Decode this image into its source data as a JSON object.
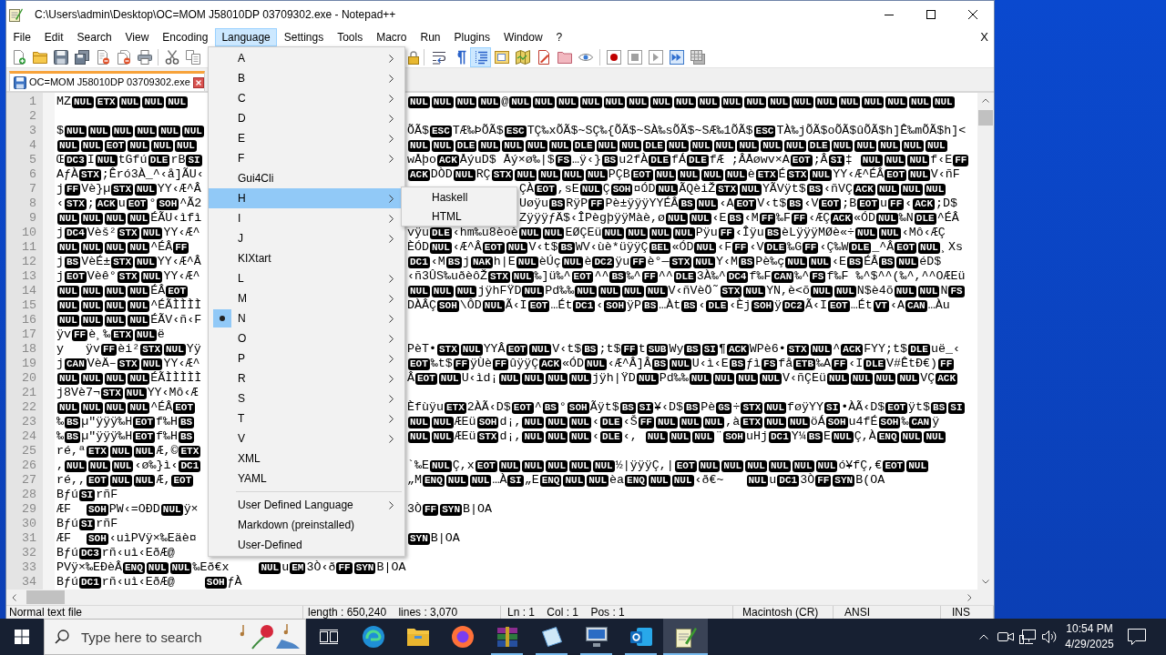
{
  "window": {
    "title": "C:\\Users\\admin\\Desktop\\OC=MOM J58010DP 03709302.exe - Notepad++"
  },
  "menu_bar": {
    "items": [
      {
        "label": "File",
        "selected": false
      },
      {
        "label": "Edit",
        "selected": false
      },
      {
        "label": "Search",
        "selected": false
      },
      {
        "label": "View",
        "selected": false
      },
      {
        "label": "Encoding",
        "selected": false
      },
      {
        "label": "Language",
        "selected": true
      },
      {
        "label": "Settings",
        "selected": false
      },
      {
        "label": "Tools",
        "selected": false
      },
      {
        "label": "Macro",
        "selected": false
      },
      {
        "label": "Run",
        "selected": false
      },
      {
        "label": "Plugins",
        "selected": false
      },
      {
        "label": "Window",
        "selected": false
      },
      {
        "label": "?",
        "selected": false
      }
    ],
    "close_button": "X"
  },
  "toolbar": {
    "buttons": [
      {
        "pressed": false
      },
      {
        "pressed": false
      },
      {
        "pressed": false
      },
      {
        "pressed": false
      },
      {
        "pressed": false
      },
      {
        "pressed": false
      },
      {
        "pressed": false
      },
      {
        "pressed": false
      },
      {
        "pressed": false
      },
      {
        "pressed": false
      },
      {
        "pressed": false
      },
      {
        "pressed": false
      },
      {
        "pressed": true
      },
      {
        "pressed": false
      },
      {
        "pressed": false
      },
      {
        "pressed": false
      },
      {
        "pressed": false
      },
      {
        "pressed": false
      },
      {
        "pressed": false
      },
      {
        "pressed": false
      },
      {
        "pressed": false
      },
      {
        "pressed": false
      },
      {
        "pressed": false
      }
    ]
  },
  "tabs": [
    {
      "label": "OC=MOM J58010DP 03709302.exe",
      "selected": true
    }
  ],
  "editor": {
    "lines": [
      {
        "number": "1",
        "left": [
          "MZ",
          [
            "NUL"
          ],
          [
            "ETX"
          ],
          [
            "NUL"
          ],
          [
            "NUL"
          ],
          [
            "NUL"
          ]
        ],
        "right": [
          [
            "NUL"
          ],
          [
            "NUL"
          ],
          [
            "NUL"
          ],
          [
            "NUL"
          ],
          "@",
          [
            "NUL"
          ],
          [
            "NUL"
          ],
          [
            "NUL"
          ],
          [
            "NUL"
          ],
          [
            "NUL"
          ],
          [
            "NUL"
          ],
          [
            "NUL"
          ],
          [
            "NUL"
          ],
          [
            "NUL"
          ],
          [
            "NUL"
          ],
          [
            "NUL"
          ],
          [
            "NUL"
          ],
          [
            "NUL"
          ],
          [
            "NUL"
          ],
          [
            "NUL"
          ],
          [
            "NUL"
          ],
          [
            "NUL"
          ],
          [
            "NUL"
          ],
          [
            "NUL"
          ]
        ]
      },
      {
        "number": "2"
      },
      {
        "number": "3",
        "left": [
          "$",
          [
            "NUL"
          ],
          [
            "NUL"
          ],
          [
            "NUL"
          ],
          [
            "NUL"
          ],
          [
            "NUL"
          ],
          [
            "NUL"
          ]
        ],
        "right": [
          "ÕÃ$",
          [
            "ESC"
          ],
          "TÆ‰ÞÕÃ$",
          [
            "ESC"
          ],
          "TÇ‰xÕÃ$~SÇ‰{ÕÃ$~SÀ‰sÕÃ$~SÆ‰1ÕÃ$",
          [
            "ESC"
          ],
          "TÀ‰jÕÃ$oÕÃ$ûÕÃ$h]Ê‰mÕÃ$h]<"
        ]
      },
      {
        "number": "4",
        "left": [
          [
            "NUL"
          ],
          [
            "NUL"
          ],
          [
            "EOT"
          ],
          [
            "NUL"
          ],
          [
            "NUL"
          ],
          [
            "NUL"
          ]
        ],
        "right": [
          [
            "NUL"
          ],
          [
            "NUL"
          ],
          [
            "DLE"
          ],
          [
            "NUL"
          ],
          [
            "NUL"
          ],
          [
            "NUL"
          ],
          [
            "NUL"
          ],
          [
            "DLE"
          ],
          [
            "NUL"
          ],
          [
            "NUL"
          ],
          [
            "DLE"
          ],
          [
            "NUL"
          ],
          [
            "NUL"
          ],
          [
            "NUL"
          ],
          [
            "NUL"
          ],
          [
            "NUL"
          ],
          [
            "NUL"
          ],
          [
            "DLE"
          ],
          [
            "NUL"
          ],
          [
            "NUL"
          ],
          [
            "NUL"
          ],
          [
            "NUL"
          ],
          [
            "NUL"
          ]
        ]
      },
      {
        "number": "5",
        "left": [
          "Œ",
          [
            "DC3"
          ],
          "I",
          [
            "NUL"
          ],
          "tGfú",
          [
            "DLE"
          ],
          "rB",
          [
            "SI"
          ]
        ],
        "right": [
          "wÅþo",
          [
            "ACK"
          ],
          "ÅýuD$ Åý×ø‰|$",
          [
            "FS"
          ],
          "…ÿ‹}",
          [
            "BS"
          ],
          "u2fÀ",
          [
            "DLE"
          ],
          "fÁ",
          [
            "DLE"
          ],
          "fÆ ;ÂÅøwv×A",
          [
            "EOT"
          ],
          ";Â",
          [
            "SI"
          ],
          "‡ ",
          [
            "NUL"
          ],
          [
            "NUL"
          ],
          [
            "NUL"
          ],
          "f‹E",
          [
            "FF"
          ]
        ]
      },
      {
        "number": "6",
        "left": [
          "AƒÀ",
          [
            "STX"
          ],
          ";Êró3À_^‹å]ÃU‹"
        ],
        "right": [
          [
            "ACK"
          ],
          "DÒD",
          [
            "NUL"
          ],
          "RÇ",
          [
            "STX"
          ],
          [
            "NUL"
          ],
          [
            "NUL"
          ],
          [
            "NUL"
          ],
          [
            "NUL"
          ],
          "PÇB",
          [
            "EOT"
          ],
          [
            "NUL"
          ],
          [
            "NUL"
          ],
          [
            "NUL"
          ],
          [
            "NUL"
          ],
          "è",
          [
            "ETX"
          ],
          "É",
          [
            "STX"
          ],
          [
            "NUL"
          ],
          "YY‹Æ^ÉÂ",
          [
            "EOT"
          ],
          [
            "NUL"
          ],
          "V‹ñF"
        ]
      },
      {
        "number": "7",
        "left": [
          "j",
          [
            "FF"
          ],
          "Vè}µ",
          [
            "STX"
          ],
          [
            "NUL"
          ],
          "YY‹Æ^Â"
        ],
        "right": [
          "ÇÀ",
          [
            "EOT"
          ],
          ",sE",
          [
            "NUL"
          ],
          "Ç",
          [
            "SOH"
          ],
          "¤ÓD",
          [
            "NUL"
          ],
          "ÃQèiŽ",
          [
            "STX"
          ],
          [
            "NUL"
          ],
          "YÃVÿt$",
          [
            "BS"
          ],
          "‹ñVÇ",
          [
            "ACK"
          ],
          [
            "NUL"
          ],
          [
            "NUL"
          ],
          [
            "NUL"
          ]
        ]
      },
      {
        "number": "8",
        "left": [
          "‹",
          [
            "STX"
          ],
          ";",
          [
            "ACK"
          ],
          "u",
          [
            "EOT"
          ],
          "°",
          [
            "SOH"
          ],
          "^Ã2"
        ],
        "right": [
          "Uøÿu",
          [
            "BS"
          ],
          "RÿP",
          [
            "FF"
          ],
          "Pè±ÿÿÿYYÉÂ",
          [
            "BS"
          ],
          [
            "NUL"
          ],
          "‹A",
          [
            "EOT"
          ],
          "V‹t$",
          [
            "BS"
          ],
          "‹V",
          [
            "EOT"
          ],
          ";B",
          [
            "EOT"
          ],
          "u",
          [
            "FF"
          ],
          "‹",
          [
            "ACK"
          ],
          ";D$"
        ]
      },
      {
        "number": "9",
        "left": [
          [
            "NUL"
          ],
          [
            "NUL"
          ],
          [
            "NUL"
          ],
          [
            "NUL"
          ],
          "ÉÃU‹ìfì"
        ],
        "right": [
          "ZÿÿÿƒÄ$‹ÎPègþÿÿMàè,ø",
          [
            "NUL"
          ],
          [
            "NUL"
          ],
          "‹E",
          [
            "BS"
          ],
          "‹M",
          [
            "FF"
          ],
          "‰F",
          [
            "FF"
          ],
          "‹ÆÇ",
          [
            "ACK"
          ],
          "«ÓD",
          [
            "NUL"
          ],
          "‰N",
          [
            "DLE"
          ],
          "^ÉÂ"
        ]
      },
      {
        "number": "10",
        "left": [
          "j",
          [
            "DC4"
          ],
          "Vèš²",
          [
            "STX"
          ],
          [
            "NUL"
          ],
          "YY‹Æ^"
        ],
        "right": [
          "vÿu",
          [
            "DLE"
          ],
          "‹hm‰u8èoè",
          [
            "NUL"
          ],
          [
            "NUL"
          ],
          "EØÇEü",
          [
            "NUL"
          ],
          [
            "NUL"
          ],
          [
            "NUL"
          ],
          [
            "NUL"
          ],
          "Pÿu",
          [
            "FF"
          ],
          "‹Îÿu",
          [
            "BS"
          ],
          "èLÿÿÿMØè«÷",
          [
            "NUL"
          ],
          [
            "NUL"
          ],
          "‹Mô‹ÆÇ"
        ]
      },
      {
        "number": "11",
        "left": [
          [
            "NUL"
          ],
          [
            "NUL"
          ],
          [
            "NUL"
          ],
          [
            "NUL"
          ],
          "^ÉÂ",
          [
            "FF"
          ]
        ],
        "right": [
          "ÈÓD",
          [
            "NUL"
          ],
          "‹Æ^Â",
          [
            "EOT"
          ],
          [
            "NUL"
          ],
          "V‹t$",
          [
            "BS"
          ],
          "WV‹ùè*üÿÿÇ",
          [
            "BEL"
          ],
          "«ÓD",
          [
            "NUL"
          ],
          "‹F",
          [
            "FF"
          ],
          "‹V",
          [
            "DLE"
          ],
          "‰G",
          [
            "FF"
          ],
          "‹Ç‰W",
          [
            "DLE"
          ],
          "_^Â",
          [
            "EOT"
          ],
          [
            "NUL"
          ],
          "¸Xs"
        ]
      },
      {
        "number": "12",
        "left": [
          "j",
          [
            "BS"
          ],
          "VèÉ±",
          [
            "STX"
          ],
          [
            "NUL"
          ],
          "YY‹Æ^Â"
        ],
        "right": [
          [
            "DC1"
          ],
          "‹M",
          [
            "BS"
          ],
          "j",
          [
            "NAK"
          ],
          "h|E",
          [
            "NUL"
          ],
          "èÚç",
          [
            "NUL"
          ],
          "è",
          [
            "DC2"
          ],
          "ÿu",
          [
            "FF"
          ],
          "è°—",
          [
            "STX"
          ],
          [
            "NUL"
          ],
          "Y‹M",
          [
            "BS"
          ],
          "Pè‰ç",
          [
            "NUL"
          ],
          [
            "NUL"
          ],
          "‹E",
          [
            "BS"
          ],
          "ÉÂ",
          [
            "BS"
          ],
          [
            "NUL"
          ],
          "éD$"
        ]
      },
      {
        "number": "13",
        "left": [
          "j",
          [
            "EOT"
          ],
          "Vèê°",
          [
            "STX"
          ],
          [
            "NUL"
          ],
          "YY‹Æ^"
        ],
        "right": [
          "‹ñ3ÛS‰uðèôŽ",
          [
            "STX"
          ],
          [
            "NUL"
          ],
          "‰]ü‰^",
          [
            "EOT"
          ],
          "^^",
          [
            "BS"
          ],
          "‰^",
          [
            "FF"
          ],
          "^^",
          [
            "DLE"
          ],
          "3À‰^",
          [
            "DC4"
          ],
          "f‰F",
          [
            "CAN"
          ],
          "‰^",
          [
            "FS"
          ],
          "f‰F ‰^$^^(‰^,^^OÆEü"
        ]
      },
      {
        "number": "14",
        "left": [
          [
            "NUL"
          ],
          [
            "NUL"
          ],
          [
            "NUL"
          ],
          [
            "NUL"
          ],
          "ÉÂ",
          [
            "EOT"
          ]
        ],
        "right": [
          [
            "NUL"
          ],
          [
            "NUL"
          ],
          [
            "NUL"
          ],
          "jÿhFŸD",
          [
            "NUL"
          ],
          "Pd‰‰",
          [
            "NUL"
          ],
          [
            "NUL"
          ],
          [
            "NUL"
          ],
          [
            "NUL"
          ],
          "V‹ñVèÖ˜",
          [
            "STX"
          ],
          [
            "NUL"
          ],
          "YN,è<õ",
          [
            "NUL"
          ],
          [
            "NUL"
          ],
          "N$è4õ",
          [
            "NUL"
          ],
          [
            "NUL"
          ],
          "N",
          [
            "FS"
          ]
        ]
      },
      {
        "number": "15",
        "left": [
          [
            "NUL"
          ],
          [
            "NUL"
          ],
          [
            "NUL"
          ],
          [
            "NUL"
          ],
          "^ÉÃÌÌÌÌ"
        ],
        "right": [
          "DÀÂÇ",
          [
            "SOH"
          ],
          "\\ÔD",
          [
            "NUL"
          ],
          "Ã",
          "‹I",
          [
            "EOT"
          ],
          "…Ét",
          [
            "DC1"
          ],
          "‹",
          [
            "SOH"
          ],
          "ÿP",
          [
            "BS"
          ],
          "…Àt",
          [
            "BS"
          ],
          "‹",
          [
            "DLE"
          ],
          "‹Èj",
          [
            "SOH"
          ],
          "ÿ",
          [
            "DC2"
          ],
          "Ã",
          "‹I",
          [
            "EOT"
          ],
          "…Ét",
          [
            "VT"
          ],
          "‹A",
          [
            "CAN"
          ],
          "…Àu"
        ]
      },
      {
        "number": "16",
        "left": [
          [
            "NUL"
          ],
          [
            "NUL"
          ],
          [
            "NUL"
          ],
          [
            "NUL"
          ],
          "ÉÃV‹ñ‹F"
        ]
      },
      {
        "number": "17",
        "left": [
          "ÿv",
          [
            "FF"
          ],
          "è¸‰",
          [
            "ETX"
          ],
          [
            "NUL"
          ],
          "ë"
        ]
      },
      {
        "number": "18",
        "left": [
          "y   ÿv",
          [
            "FF"
          ],
          "èi²",
          [
            "STX"
          ],
          [
            "NUL"
          ],
          "Yÿ"
        ],
        "right": [
          "PèT•",
          [
            "STX"
          ],
          [
            "NUL"
          ],
          "YYÂ",
          [
            "EOT"
          ],
          [
            "NUL"
          ],
          "V‹t$",
          [
            "BS"
          ],
          ";t$",
          [
            "FF"
          ],
          "t",
          [
            "SUB"
          ],
          "Wy",
          [
            "BS"
          ],
          [
            "SI"
          ],
          "¶",
          [
            "ACK"
          ],
          "WPè6•",
          [
            "STX"
          ],
          [
            "NUL"
          ],
          "^",
          [
            "ACK"
          ],
          "FYY;t$",
          [
            "DLE"
          ],
          "uë_‹"
        ]
      },
      {
        "number": "19",
        "left": [
          "j",
          [
            "CAN"
          ],
          "VèÄ–",
          [
            "STX"
          ],
          [
            "NUL"
          ],
          "YY‹Æ^"
        ],
        "right": [
          [
            "EOT"
          ],
          "‰t$",
          [
            "FF"
          ],
          "ÿÙè",
          [
            "FF"
          ],
          "ûÿÿÇ",
          [
            "ACK"
          ],
          "«ÓD",
          [
            "NUL"
          ],
          "‹Æ^Â]Â",
          [
            "BS"
          ],
          [
            "NUL"
          ],
          "U‹ì‹E",
          [
            "BS"
          ],
          "ƒì",
          [
            "FS"
          ],
          "få",
          [
            "ETB"
          ],
          "‰A",
          [
            "FF"
          ],
          "‹I",
          [
            "DLE"
          ],
          "V#ÊtÐ€)",
          [
            "FF"
          ]
        ]
      },
      {
        "number": "20",
        "left": [
          [
            "NUL"
          ],
          [
            "NUL"
          ],
          [
            "NUL"
          ],
          [
            "NUL"
          ],
          "ÉÃÌÌÌÌÌ"
        ],
        "right": [
          "Â",
          [
            "EOT"
          ],
          [
            "NUL"
          ],
          "U‹ìd¡",
          [
            "NUL"
          ],
          [
            "NUL"
          ],
          [
            "NUL"
          ],
          [
            "NUL"
          ],
          "jÿh|ŸD",
          [
            "NUL"
          ],
          "Pd‰‰",
          [
            "NUL"
          ],
          [
            "NUL"
          ],
          [
            "NUL"
          ],
          [
            "NUL"
          ],
          "V‹ñÇEü",
          [
            "NUL"
          ],
          [
            "NUL"
          ],
          [
            "NUL"
          ],
          [
            "NUL"
          ],
          "VÇ",
          [
            "ACK"
          ]
        ]
      },
      {
        "number": "21",
        "left": [
          "j8Vè7¬",
          [
            "STX"
          ],
          [
            "NUL"
          ],
          "YY‹Mô‹Æ"
        ]
      },
      {
        "number": "22",
        "left": [
          [
            "NUL"
          ],
          [
            "NUL"
          ],
          [
            "NUL"
          ],
          [
            "NUL"
          ],
          "^ÉÂ",
          [
            "EOT"
          ]
        ],
        "right": [
          "Èfùÿu",
          [
            "ETX"
          ],
          "2ÀÃ",
          "‹D$",
          [
            "EOT"
          ],
          "^",
          [
            "BS"
          ],
          "°",
          [
            "SOH"
          ],
          "Ãÿt$",
          [
            "BS"
          ],
          [
            "SI"
          ],
          "¥‹D$",
          [
            "BS"
          ],
          "Pè",
          [
            "GS"
          ],
          "÷",
          [
            "STX"
          ],
          [
            "NUL"
          ],
          "føÿYY",
          [
            "SI"
          ],
          "•ÀÃ",
          "‹D$",
          [
            "EOT"
          ],
          "ÿt$",
          [
            "BS"
          ],
          [
            "SI"
          ]
        ]
      },
      {
        "number": "23",
        "left": [
          "‰",
          [
            "BS"
          ],
          "µ\"ÿÿÿ‰H",
          [
            "EOT"
          ],
          "f‰H",
          [
            "BS"
          ]
        ],
        "right": [
          [
            "NUL"
          ],
          [
            "NUL"
          ],
          "ÆEü",
          [
            "SOH"
          ],
          "d¡,",
          [
            "NUL"
          ],
          [
            "NUL"
          ],
          [
            "NUL"
          ],
          "‹",
          [
            "DLE"
          ],
          "‹Š",
          [
            "FF"
          ],
          [
            "NUL"
          ],
          [
            "NUL"
          ],
          [
            "NUL"
          ],
          ",à",
          [
            "ETX"
          ],
          [
            "NUL"
          ],
          [
            "NUL"
          ],
          "öÁ",
          [
            "SOH"
          ],
          "u4fÉ",
          [
            "SOH"
          ],
          "‰",
          [
            "CAN"
          ],
          "ÿ"
        ]
      },
      {
        "number": "24",
        "left": [
          "‰",
          [
            "BS"
          ],
          "µ\"ÿÿÿ‰H",
          [
            "EOT"
          ],
          "f‰H",
          [
            "BS"
          ]
        ],
        "right": [
          [
            "NUL"
          ],
          [
            "NUL"
          ],
          "ÆEü",
          [
            "STX"
          ],
          "d¡,",
          [
            "NUL"
          ],
          [
            "NUL"
          ],
          [
            "NUL"
          ],
          "‹",
          [
            "DLE"
          ],
          "‹, ",
          [
            "NUL"
          ],
          [
            "NUL"
          ],
          [
            "NUL"
          ],
          "¨",
          [
            "SOH"
          ],
          "uHj",
          [
            "DC1"
          ],
          "Y¼",
          [
            "BS"
          ],
          "E",
          [
            "NUL"
          ],
          "Ç,À",
          [
            "ENQ"
          ],
          [
            "NUL"
          ],
          [
            "NUL"
          ]
        ]
      },
      {
        "number": "25",
        "left": [
          "ré,ª",
          [
            "ETX"
          ],
          [
            "NUL"
          ],
          [
            "NUL"
          ],
          "Æ,©",
          [
            "ETX"
          ]
        ]
      },
      {
        "number": "26",
        "left": [
          ",",
          [
            "NUL"
          ],
          [
            "NUL"
          ],
          [
            "NUL"
          ],
          "‹ø‰}ì‹",
          [
            "DC1"
          ]
        ],
        "right": [
          "`‰E",
          [
            "NUL"
          ],
          "Ç,x",
          [
            "EOT"
          ],
          [
            "NUL"
          ],
          [
            "NUL"
          ],
          [
            "NUL"
          ],
          [
            "NUL"
          ],
          [
            "NUL"
          ],
          "½|ÿÿÿÇ,|",
          [
            "EOT"
          ],
          [
            "NUL"
          ],
          [
            "NUL"
          ],
          [
            "NUL"
          ],
          [
            "NUL"
          ],
          [
            "NUL"
          ],
          [
            "NUL"
          ],
          "ó¥fÇ,€",
          [
            "EOT"
          ],
          [
            "NUL"
          ]
        ]
      },
      {
        "number": "27",
        "left": [
          "ré,,",
          [
            "EOT"
          ],
          [
            "NUL"
          ],
          [
            "NUL"
          ],
          "Æ,",
          [
            "EOT"
          ]
        ],
        "right": [
          "„M",
          [
            "ENQ"
          ],
          [
            "NUL"
          ],
          [
            "NUL"
          ],
          "…À",
          [
            "SI"
          ],
          "„E",
          [
            "ENQ"
          ],
          [
            "NUL"
          ],
          [
            "NUL"
          ],
          "èa",
          [
            "ENQ"
          ],
          [
            "NUL"
          ],
          [
            "NUL"
          ],
          "‹ð€~   ",
          [
            "NUL"
          ],
          "u",
          [
            "DC1"
          ],
          "3Ò",
          [
            "FF"
          ],
          [
            "SYN"
          ],
          "B(OA"
        ]
      },
      {
        "number": "28",
        "left": [
          "Bƒú",
          [
            "SI"
          ],
          "rñF"
        ]
      },
      {
        "number": "29",
        "left": [
          "ÆF  ",
          [
            "SOH"
          ],
          "PW‹=OÐD",
          [
            "NUL"
          ],
          "ÿ×"
        ],
        "right": [
          "3Ò",
          [
            "FF"
          ],
          [
            "SYN"
          ],
          "B|OA"
        ]
      },
      {
        "number": "30",
        "left": [
          "Bƒú",
          [
            "SI"
          ],
          "rñF"
        ]
      },
      {
        "number": "31",
        "left": [
          "ÆF  ",
          [
            "SOH"
          ],
          "‹uìPVÿ×‰Eäè¤"
        ],
        "right": [
          [
            "SYN"
          ],
          "B|OA"
        ]
      },
      {
        "number": "32",
        "left": [
          "Bƒú",
          [
            "DC3"
          ],
          "rñ‹uì‹EðÆ@"
        ]
      },
      {
        "number": "33",
        "left": [
          "PVÿ×‰EÐèÂ",
          [
            "ENQ"
          ],
          [
            "NUL"
          ],
          [
            "NUL"
          ],
          "‰Eð€x    ",
          [
            "NUL"
          ],
          "u",
          [
            "EM"
          ],
          "3Ò‹ð",
          [
            "FF"
          ],
          [
            "SYN"
          ],
          "B|OA"
        ]
      },
      {
        "number": "34",
        "left": [
          "Bƒú",
          [
            "DC1"
          ],
          "rñ‹uì‹EðÆ@    ",
          [
            "SOH"
          ],
          "ƒÀ"
        ]
      }
    ]
  },
  "language_menu": {
    "items": [
      {
        "kind": "item",
        "label": "A",
        "submenu": true,
        "selected": false,
        "checked": false
      },
      {
        "kind": "item",
        "label": "B",
        "submenu": true,
        "selected": false,
        "checked": false
      },
      {
        "kind": "item",
        "label": "C",
        "submenu": true,
        "selected": false,
        "checked": false
      },
      {
        "kind": "item",
        "label": "D",
        "submenu": true,
        "selected": false,
        "checked": false
      },
      {
        "kind": "item",
        "label": "E",
        "submenu": true,
        "selected": false,
        "checked": false
      },
      {
        "kind": "item",
        "label": "F",
        "submenu": true,
        "selected": false,
        "checked": false
      },
      {
        "kind": "item",
        "label": "Gui4Cli",
        "submenu": false,
        "selected": false,
        "checked": false
      },
      {
        "kind": "item",
        "label": "H",
        "submenu": true,
        "selected": true,
        "checked": false
      },
      {
        "kind": "item",
        "label": "I",
        "submenu": true,
        "selected": false,
        "checked": false
      },
      {
        "kind": "item",
        "label": "J",
        "submenu": true,
        "selected": false,
        "checked": false
      },
      {
        "kind": "item",
        "label": "KIXtart",
        "submenu": false,
        "selected": false,
        "checked": false
      },
      {
        "kind": "item",
        "label": "L",
        "submenu": true,
        "selected": false,
        "checked": false
      },
      {
        "kind": "item",
        "label": "M",
        "submenu": true,
        "selected": false,
        "checked": false
      },
      {
        "kind": "item",
        "label": "N",
        "submenu": true,
        "selected": false,
        "checked": true
      },
      {
        "kind": "item",
        "label": "O",
        "submenu": true,
        "selected": false,
        "checked": false
      },
      {
        "kind": "item",
        "label": "P",
        "submenu": true,
        "selected": false,
        "checked": false
      },
      {
        "kind": "item",
        "label": "R",
        "submenu": true,
        "selected": false,
        "checked": false
      },
      {
        "kind": "item",
        "label": "S",
        "submenu": true,
        "selected": false,
        "checked": false
      },
      {
        "kind": "item",
        "label": "T",
        "submenu": true,
        "selected": false,
        "checked": false
      },
      {
        "kind": "item",
        "label": "V",
        "submenu": true,
        "selected": false,
        "checked": false
      },
      {
        "kind": "item",
        "label": "XML",
        "submenu": false,
        "selected": false,
        "checked": false
      },
      {
        "kind": "item",
        "label": "YAML",
        "submenu": false,
        "selected": false,
        "checked": false
      },
      {
        "kind": "separator"
      },
      {
        "kind": "item",
        "label": "User Defined Language",
        "submenu": true,
        "selected": false,
        "checked": false
      },
      {
        "kind": "item",
        "label": "Markdown (preinstalled)",
        "submenu": false,
        "selected": false,
        "checked": false
      },
      {
        "kind": "item",
        "label": "User-Defined",
        "submenu": false,
        "selected": false,
        "checked": false
      }
    ]
  },
  "h_submenu": {
    "items": [
      {
        "label": "Haskell",
        "selected": false
      },
      {
        "label": "HTML",
        "selected": false
      }
    ]
  },
  "status_bar": {
    "cells": [
      "Normal text file",
      "length : 650,240    lines : 3,070",
      "Ln : 1    Col : 1    Pos : 1",
      "Macintosh (CR)",
      "ANSI",
      "INS"
    ]
  },
  "taskbar": {
    "search": {
      "placeholder": "Type here to search"
    },
    "apps": [
      {
        "running": false,
        "active": false
      },
      {
        "running": false,
        "active": false
      },
      {
        "running": false,
        "active": false
      },
      {
        "running": true,
        "active": false
      },
      {
        "running": true,
        "active": false
      },
      {
        "running": true,
        "active": false
      },
      {
        "running": true,
        "active": false
      },
      {
        "running": true,
        "active": true
      }
    ],
    "clock": {
      "time": "10:54 PM",
      "date": "4/29/2025"
    }
  }
}
